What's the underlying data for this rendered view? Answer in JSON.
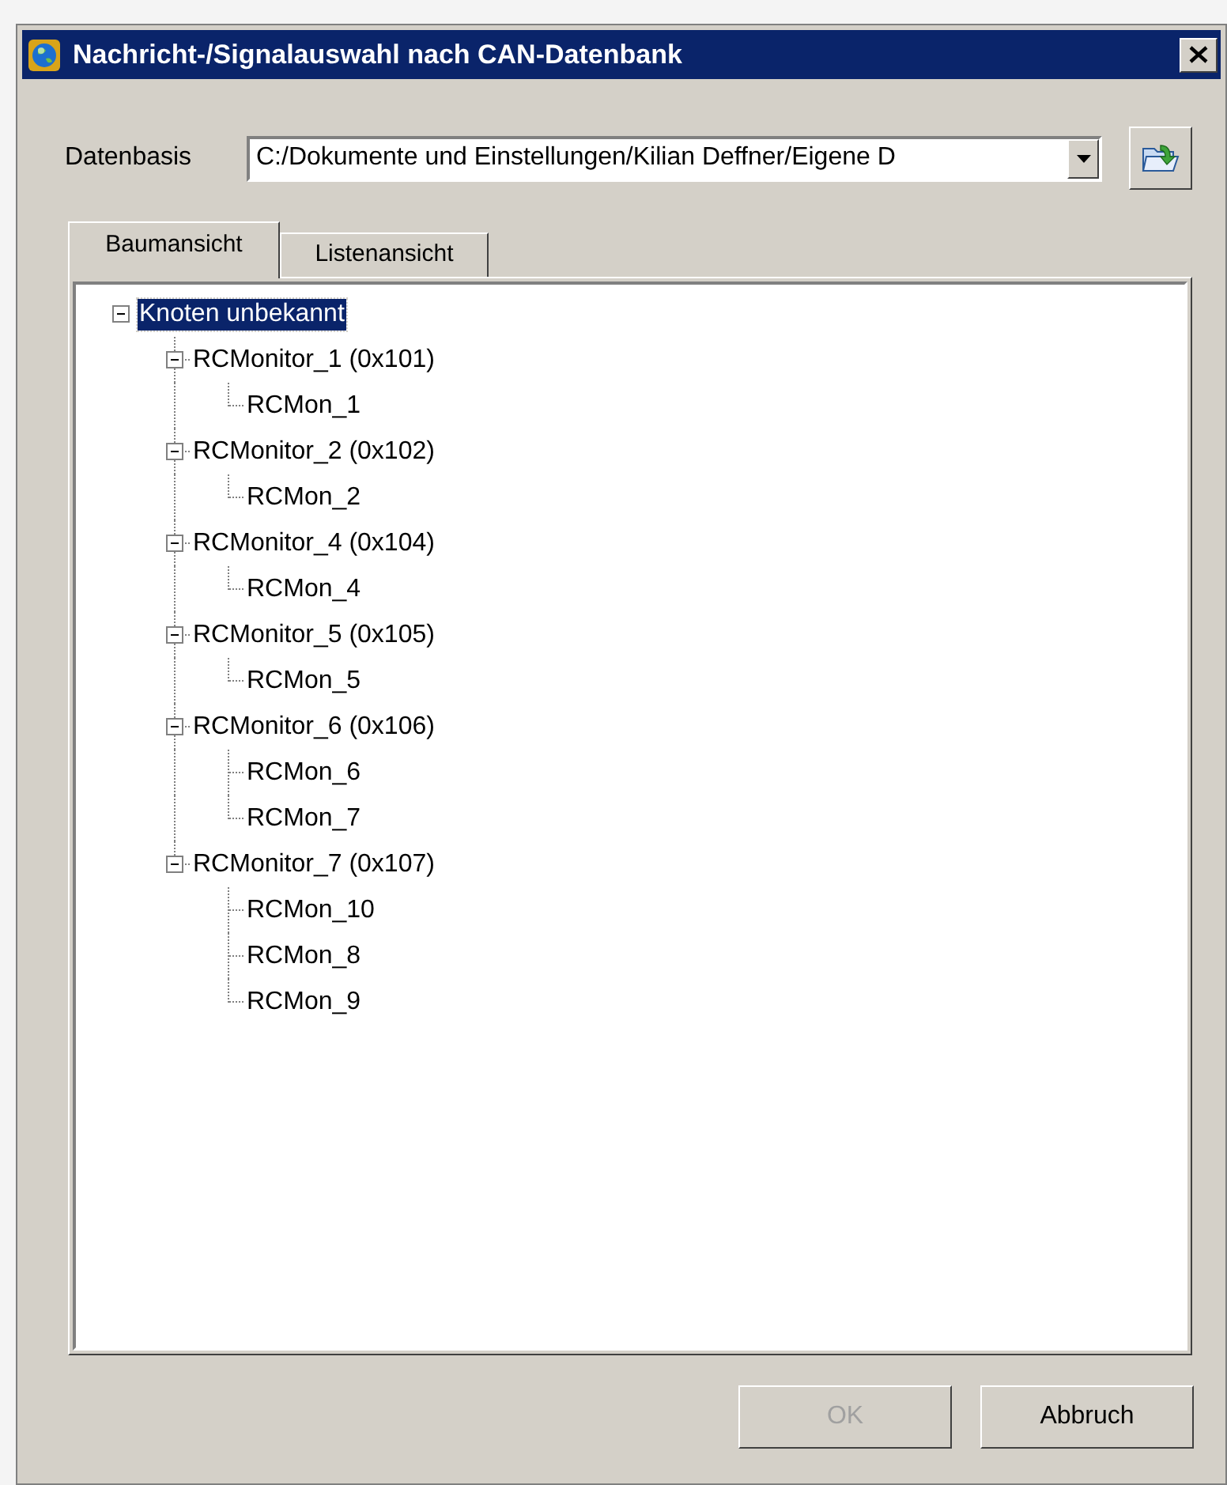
{
  "window": {
    "title": "Nachricht-/Signalauswahl nach CAN-Datenbank"
  },
  "database": {
    "label": "Datenbasis",
    "value": "C:/Dokumente und Einstellungen/Kilian Deffner/Eigene D"
  },
  "tabs": [
    {
      "label": "Baumansicht",
      "selected": true
    },
    {
      "label": "Listenansicht",
      "selected": false
    }
  ],
  "tree": [
    {
      "label": "Knoten unbekannt",
      "selected": true,
      "expanded": true,
      "children": [
        {
          "label": "RCMonitor_1 (0x101)",
          "selected": false,
          "expanded": true,
          "children": [
            {
              "label": "RCMon_1",
              "selected": false
            }
          ]
        },
        {
          "label": "RCMonitor_2 (0x102)",
          "selected": false,
          "expanded": true,
          "children": [
            {
              "label": "RCMon_2",
              "selected": false
            }
          ]
        },
        {
          "label": "RCMonitor_4 (0x104)",
          "selected": false,
          "expanded": true,
          "children": [
            {
              "label": "RCMon_4",
              "selected": false
            }
          ]
        },
        {
          "label": "RCMonitor_5 (0x105)",
          "selected": false,
          "expanded": true,
          "children": [
            {
              "label": "RCMon_5",
              "selected": false
            }
          ]
        },
        {
          "label": "RCMonitor_6 (0x106)",
          "selected": false,
          "expanded": true,
          "children": [
            {
              "label": "RCMon_6",
              "selected": false
            },
            {
              "label": "RCMon_7",
              "selected": false
            }
          ]
        },
        {
          "label": "RCMonitor_7 (0x107)",
          "selected": false,
          "expanded": true,
          "children": [
            {
              "label": "RCMon_10",
              "selected": false
            },
            {
              "label": "RCMon_8",
              "selected": false
            },
            {
              "label": "RCMon_9",
              "selected": false
            }
          ]
        }
      ]
    }
  ],
  "buttons": [
    {
      "label": "OK",
      "disabled": true
    },
    {
      "label": "Abbruch",
      "disabled": false
    }
  ]
}
